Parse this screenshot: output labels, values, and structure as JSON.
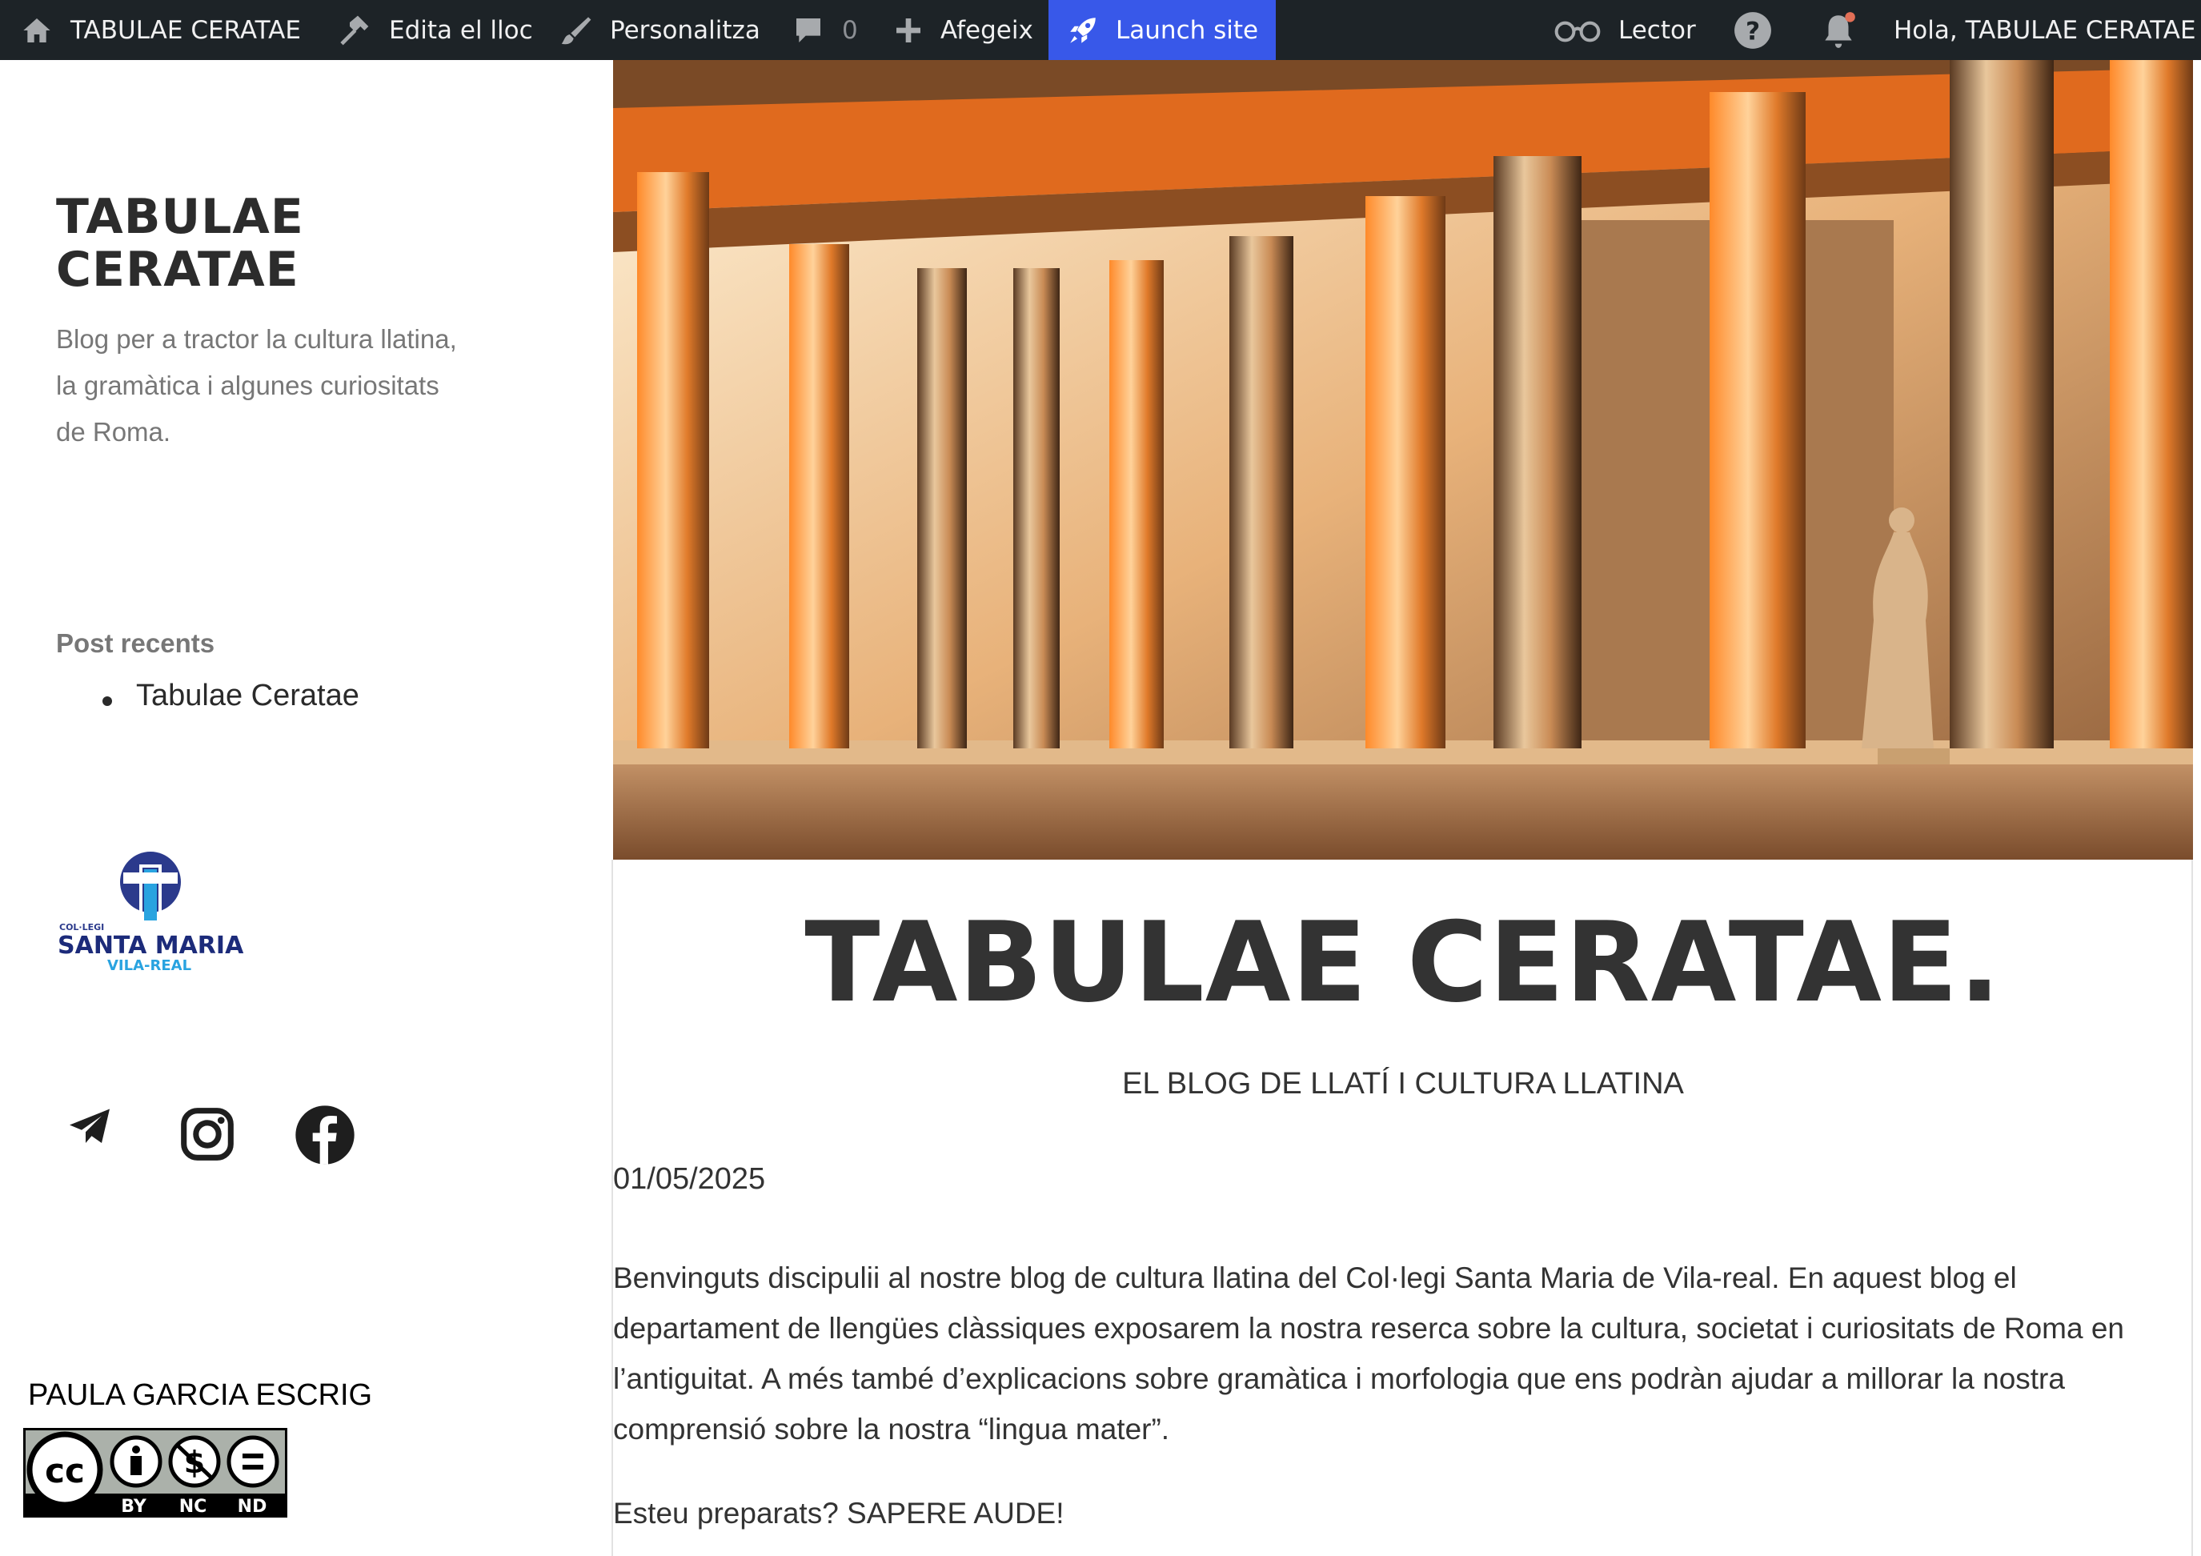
{
  "admin_bar": {
    "site_name": "TABULAE CERATAE",
    "edit_site": "Edita el lloc",
    "customize": "Personalitza",
    "comments_count": "0",
    "add_new": "Afegeix",
    "launch_site": "Launch site",
    "reader": "Lector",
    "greeting": "Hola, TABULAE CERATAE",
    "notification_dot_color": "#e26f56",
    "launch_color": "#3858e9"
  },
  "sidebar": {
    "site_title": "TABULAE CERATAE",
    "tagline": "Blog per a tractor la cultura llatina, la gramàtica i algunes curiositats de Roma.",
    "recent_posts_heading": "Post recents",
    "recent_posts": [
      "Tabulae Ceratae"
    ],
    "logo": {
      "prefix": "COL·LEGI",
      "name": "SANTA MARIA",
      "place": "VILA-REAL"
    },
    "social_icons": [
      "telegram-icon",
      "instagram-icon",
      "facebook-icon"
    ],
    "author": "PAULA GARCIA ESCRIG",
    "license": {
      "labels": [
        "BY",
        "NC",
        "ND"
      ]
    }
  },
  "post": {
    "title": "TABULAE CERATAE.",
    "subtitle": "EL BLOG DE LLATÍ I CULTURA LLATINA",
    "date": "01/05/2025",
    "body": "Benvinguts discipulii al nostre blog de cultura llatina del Col·legi Santa Maria de Vila-real. En aquest blog el departament de llengües clàssiques exposarem la nostra reserca sobre la cultura, societat i curiositats de Roma en l’antiguitat. A més també d’explicacions sobre gramàtica i morfologia que ens podràn ajudar a millorar la nostra comprensió sobre la nostra “lingua mater”.",
    "closing": "Esteu preparats? SAPERE AUDE!"
  }
}
